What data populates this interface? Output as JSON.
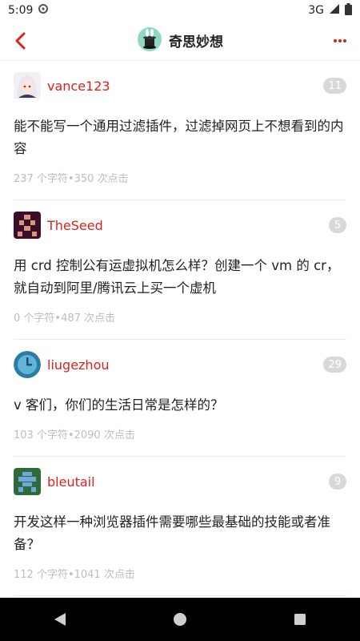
{
  "status_bar": {
    "time": "5:09",
    "network": "3G"
  },
  "header": {
    "title": "奇思妙想"
  },
  "topics": [
    {
      "username": "vance123",
      "reply_count": "11",
      "title": "能不能写一个通用过滤插件，过滤掉网页上不想看到的内容",
      "meta": "237 个字符•350 次点击"
    },
    {
      "username": "TheSeed",
      "reply_count": "5",
      "title": "用 crd 控制公有运虚拟机怎么样？创建一个 vm 的 cr，就自动到阿里/腾讯云上买一个虚机",
      "meta": "0 个字符•487 次点击"
    },
    {
      "username": "liugezhou",
      "reply_count": "29",
      "title": "v 客们，你们的生活日常是怎样的？",
      "meta": "103 个字符•2090 次点击"
    },
    {
      "username": "bleutail",
      "reply_count": "9",
      "title": "开发这样一种浏览器插件需要哪些最基础的技能或者准备？",
      "meta": "112 个字符•1041 次点击"
    }
  ],
  "colors": {
    "accent": "#e0201b",
    "badge": "#d8d8d8",
    "meta": "#bdbdbd"
  }
}
